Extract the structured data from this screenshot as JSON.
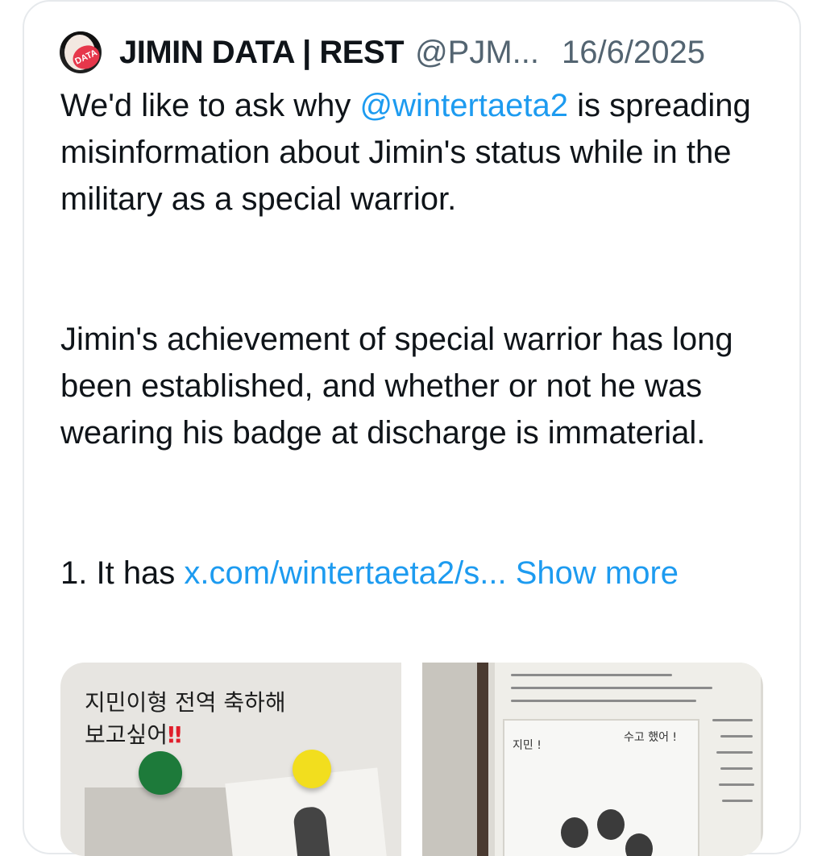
{
  "tweet": {
    "display_name": "JIMIN DATA | REST",
    "handle": "@PJM...",
    "date": "16/6/2025",
    "avatar_logo_text": "DATA",
    "body": {
      "p1_pre": "We'd like to ask why ",
      "p1_mention": "@wintertaeta2",
      "p1_post": " is spreading misinformation about Jimin's status while in the military as a special warrior.",
      "p2": "Jimin's achievement of special warrior has long been established, and whether or not he was wearing his badge at discharge is immaterial.",
      "p3_pre": "1. It has ",
      "p3_link": "x.com/wintertaeta2/s...",
      "show_more": "Show more"
    },
    "media": {
      "image1_line1": "지민이형 전역 축하해",
      "image1_line2": "보고싶어",
      "image1_exclaim": "‼",
      "image2_caption1": "지민 !",
      "image2_caption2": "수고 했어 !"
    }
  },
  "colors": {
    "link": "#1d9bf0",
    "text": "#0f1419",
    "secondary": "#536471",
    "border": "#e6e9ec"
  }
}
